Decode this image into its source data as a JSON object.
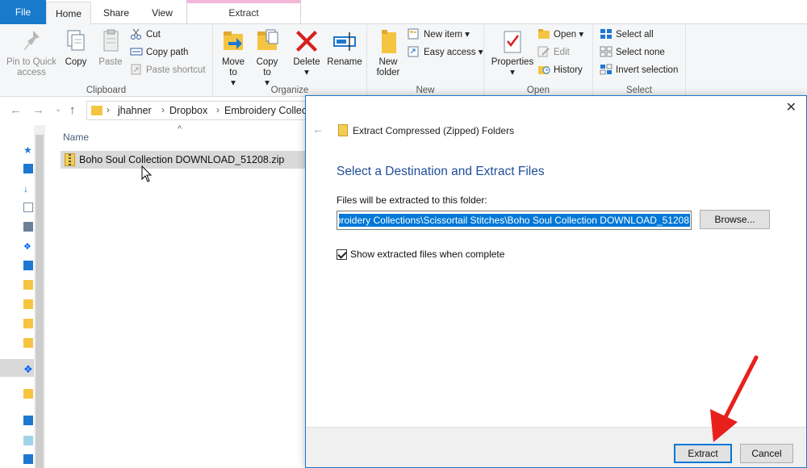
{
  "ribbon": {
    "tabs": {
      "file": "File",
      "home": "Home",
      "share": "Share",
      "view": "View",
      "extract": "Extract"
    },
    "groups": {
      "clipboard": {
        "label": "Clipboard",
        "pin": "Pin to Quick access",
        "copy": "Copy",
        "paste": "Paste",
        "cut": "Cut",
        "copy_path": "Copy path",
        "paste_shortcut": "Paste shortcut"
      },
      "organize": {
        "label": "Organize",
        "move_to": "Move to",
        "copy_to": "Copy to",
        "delete": "Delete",
        "rename": "Rename"
      },
      "new": {
        "label": "New",
        "new_folder": "New folder",
        "new_item": "New item",
        "easy_access": "Easy access"
      },
      "open": {
        "label": "Open",
        "properties": "Properties",
        "open": "Open",
        "edit": "Edit",
        "history": "History"
      },
      "select": {
        "label": "Select",
        "select_all": "Select all",
        "select_none": "Select none",
        "invert_selection": "Invert selection"
      }
    }
  },
  "address": {
    "crumbs": [
      "jhahner",
      "Dropbox",
      "Embroidery Collect"
    ]
  },
  "filelist": {
    "column_name": "Name",
    "files": [
      {
        "name": "Boho Soul Collection DOWNLOAD_51208.zip"
      }
    ]
  },
  "dialog": {
    "title": "Extract Compressed (Zipped) Folders",
    "heading": "Select a Destination and Extract Files",
    "path_label": "Files will be extracted to this folder:",
    "path_value": "broidery Collections\\Scissortail Stitches\\Boho Soul Collection DOWNLOAD_51208",
    "browse": "Browse...",
    "checkbox_label": "Show extracted files when complete",
    "checkbox_checked": true,
    "extract": "Extract",
    "cancel": "Cancel"
  },
  "colors": {
    "accent": "#1979ca",
    "selection": "#0078d7",
    "heading": "#1f4e99",
    "annotation": "#e8201c"
  }
}
